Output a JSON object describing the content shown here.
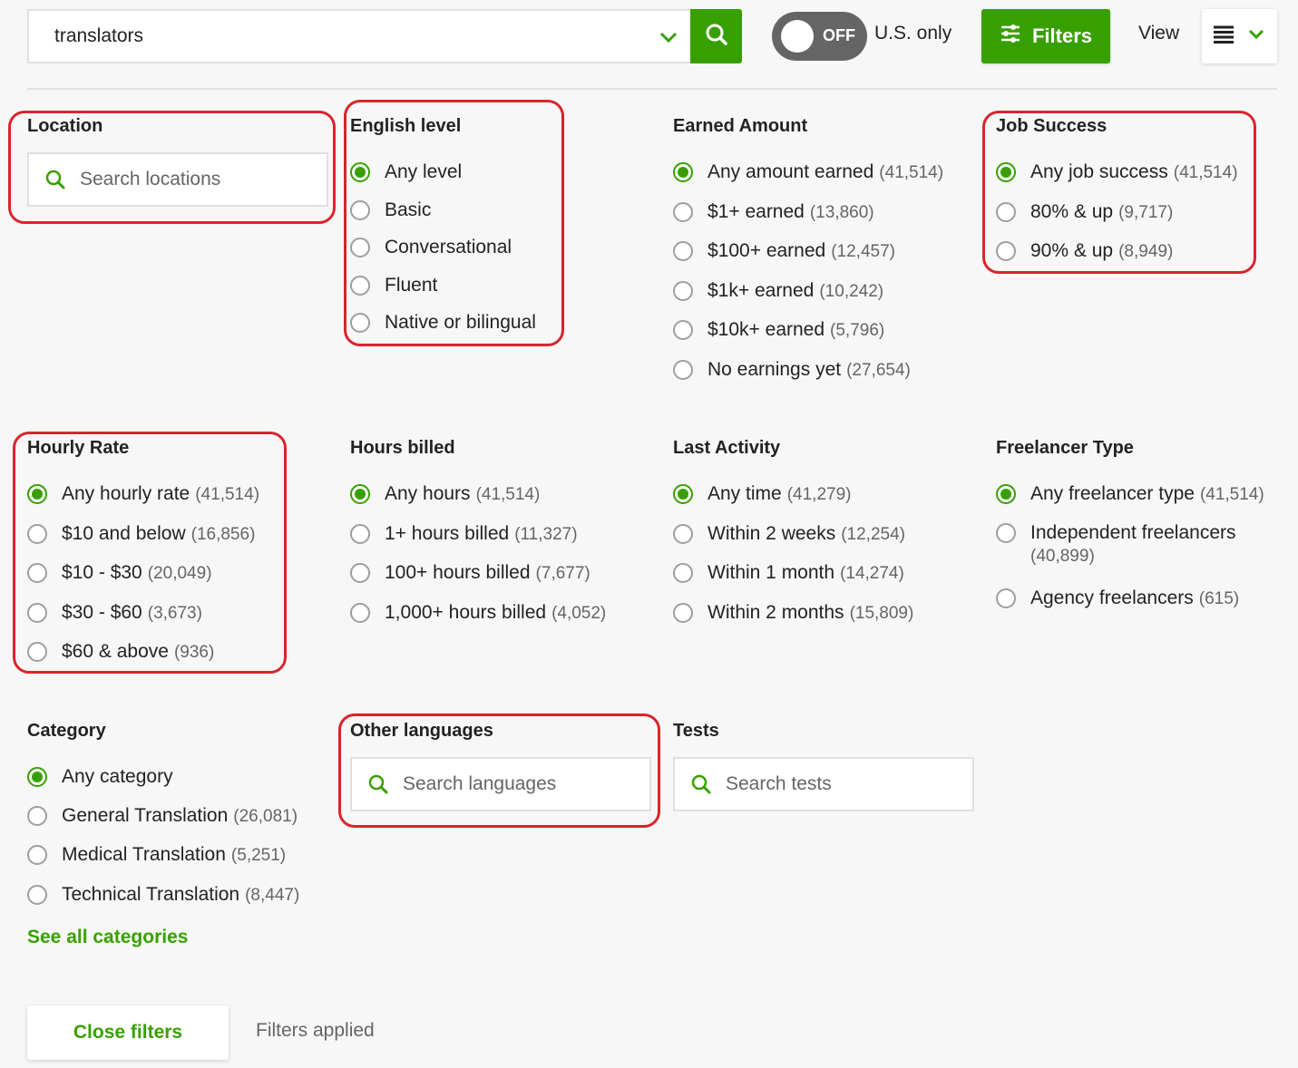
{
  "search": {
    "value": "translators",
    "icon": "search-icon"
  },
  "toggle": {
    "state": "OFF",
    "label": "U.S. only"
  },
  "toolbar": {
    "filters_label": "Filters",
    "view_label": "View",
    "view_icon": "list-view-icon"
  },
  "colors": {
    "accent": "#37a000",
    "highlight": "#d9242b",
    "toggle_off": "#656565"
  },
  "sections": {
    "location": {
      "title": "Location",
      "placeholder": "Search locations"
    },
    "english": {
      "title": "English level",
      "options": [
        {
          "label": "Any level",
          "count": "",
          "checked": true
        },
        {
          "label": "Basic",
          "count": "",
          "checked": false
        },
        {
          "label": "Conversational",
          "count": "",
          "checked": false
        },
        {
          "label": "Fluent",
          "count": "",
          "checked": false
        },
        {
          "label": "Native or bilingual",
          "count": "",
          "checked": false
        }
      ]
    },
    "earned": {
      "title": "Earned Amount",
      "options": [
        {
          "label": "Any amount earned",
          "count": "(41,514)",
          "checked": true
        },
        {
          "label": "$1+ earned",
          "count": "(13,860)",
          "checked": false
        },
        {
          "label": "$100+ earned",
          "count": "(12,457)",
          "checked": false
        },
        {
          "label": "$1k+ earned",
          "count": "(10,242)",
          "checked": false
        },
        {
          "label": "$10k+ earned",
          "count": "(5,796)",
          "checked": false
        },
        {
          "label": "No earnings yet",
          "count": "(27,654)",
          "checked": false
        }
      ]
    },
    "job_success": {
      "title": "Job Success",
      "options": [
        {
          "label": "Any job success",
          "count": "(41,514)",
          "checked": true
        },
        {
          "label": "80% & up",
          "count": "(9,717)",
          "checked": false
        },
        {
          "label": "90% & up",
          "count": "(8,949)",
          "checked": false
        }
      ]
    },
    "hourly": {
      "title": "Hourly Rate",
      "options": [
        {
          "label": "Any hourly rate",
          "count": "(41,514)",
          "checked": true
        },
        {
          "label": "$10 and below",
          "count": "(16,856)",
          "checked": false
        },
        {
          "label": "$10 - $30",
          "count": "(20,049)",
          "checked": false
        },
        {
          "label": "$30 - $60",
          "count": "(3,673)",
          "checked": false
        },
        {
          "label": "$60 & above",
          "count": "(936)",
          "checked": false
        }
      ]
    },
    "hours": {
      "title": "Hours billed",
      "options": [
        {
          "label": "Any hours",
          "count": "(41,514)",
          "checked": true
        },
        {
          "label": "1+ hours billed",
          "count": "(11,327)",
          "checked": false
        },
        {
          "label": "100+ hours billed",
          "count": "(7,677)",
          "checked": false
        },
        {
          "label": "1,000+ hours billed",
          "count": "(4,052)",
          "checked": false
        }
      ]
    },
    "activity": {
      "title": "Last Activity",
      "options": [
        {
          "label": "Any time",
          "count": "(41,279)",
          "checked": true
        },
        {
          "label": "Within 2 weeks",
          "count": "(12,254)",
          "checked": false
        },
        {
          "label": "Within 1 month",
          "count": "(14,274)",
          "checked": false
        },
        {
          "label": "Within 2 months",
          "count": "(15,809)",
          "checked": false
        }
      ]
    },
    "freelancer_type": {
      "title": "Freelancer Type",
      "options": [
        {
          "label": "Any freelancer type",
          "count": "(41,514)",
          "checked": true
        },
        {
          "label": "Independent freelancers",
          "count": "(40,899)",
          "checked": false
        },
        {
          "label": "Agency freelancers",
          "count": "(615)",
          "checked": false
        }
      ]
    },
    "category": {
      "title": "Category",
      "options": [
        {
          "label": "Any category",
          "count": "",
          "checked": true
        },
        {
          "label": "General Translation",
          "count": "(26,081)",
          "checked": false
        },
        {
          "label": "Medical Translation",
          "count": "(5,251)",
          "checked": false
        },
        {
          "label": "Technical Translation",
          "count": "(8,447)",
          "checked": false
        }
      ],
      "see_all": "See all categories"
    },
    "languages": {
      "title": "Other languages",
      "placeholder": "Search languages"
    },
    "tests": {
      "title": "Tests",
      "placeholder": "Search tests"
    }
  },
  "footer": {
    "close_label": "Close filters",
    "status": "Filters applied"
  }
}
